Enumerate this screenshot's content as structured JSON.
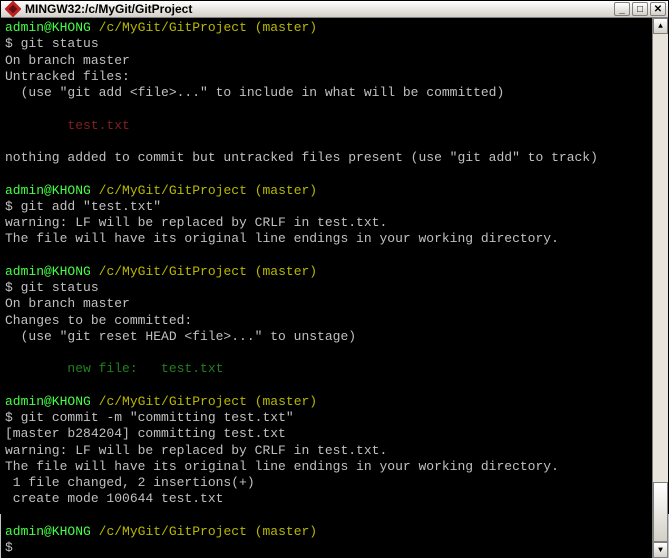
{
  "window": {
    "title": "MINGW32:/c/MyGit/GitProject"
  },
  "prompt": {
    "user_host": "admin@KHONG",
    "path": "/c/MyGit/GitProject",
    "branch": "(master)",
    "dollar": "$"
  },
  "block1": {
    "cmd": "git status",
    "l1": "On branch master",
    "l2": "Untracked files:",
    "l3": "  (use \"git add <file>...\" to include in what will be committed)",
    "file": "        test.txt",
    "l4": "nothing added to commit but untracked files present (use \"git add\" to track)"
  },
  "block2": {
    "cmd": "git add \"test.txt\"",
    "l1": "warning: LF will be replaced by CRLF in test.txt.",
    "l2": "The file will have its original line endings in your working directory."
  },
  "block3": {
    "cmd": "git status",
    "l1": "On branch master",
    "l2": "Changes to be committed:",
    "l3": "  (use \"git reset HEAD <file>...\" to unstage)",
    "file": "        new file:   test.txt"
  },
  "block4": {
    "cmd": "git commit -m \"committing test.txt\"",
    "l1": "[master b284204] committing test.txt",
    "l2": "warning: LF will be replaced by CRLF in test.txt.",
    "l3": "The file will have its original line endings in your working directory.",
    "l4": " 1 file changed, 2 insertions(+)",
    "l5": " create mode 100644 test.txt"
  }
}
